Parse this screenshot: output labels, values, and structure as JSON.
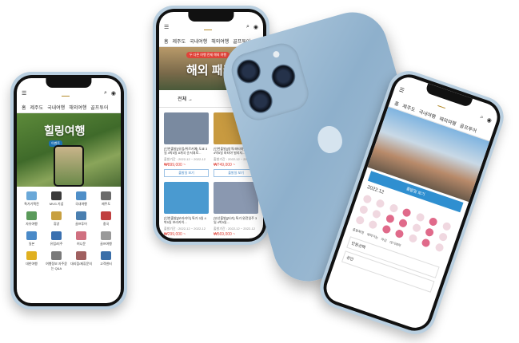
{
  "phone_left": {
    "nav": [
      "홈",
      "제주도",
      "국내여행",
      "해외여행",
      "골프투어"
    ],
    "hero_text": "힐링여행",
    "hero_badge": "이벤트",
    "grid": [
      {
        "label": "특가기획전",
        "color": "#6aa8d8"
      },
      {
        "label": "MVG 기념",
        "color": "#3a3a3a"
      },
      {
        "label": "국내여행",
        "color": "#4f8fc8"
      },
      {
        "label": "제주도",
        "color": "#6b6b6b"
      },
      {
        "label": "자유여행",
        "color": "#5a9a5a"
      },
      {
        "label": "휴양",
        "color": "#c8a040"
      },
      {
        "label": "골프투어",
        "color": "#4a7fb0"
      },
      {
        "label": "중국",
        "color": "#c04040"
      },
      {
        "label": "일본",
        "color": "#4a8ac8"
      },
      {
        "label": "유럽/미주",
        "color": "#3a70b0"
      },
      {
        "label": "허니문",
        "color": "#d07080"
      },
      {
        "label": "골프여행",
        "color": "#999999"
      },
      {
        "label": "대한여행",
        "color": "#e0b020"
      },
      {
        "label": "여행정보 자주묻는 Q&A",
        "color": "#7a7a7a"
      },
      {
        "label": "대리점/제휴문의",
        "color": "#a06060"
      },
      {
        "label": "고객센터",
        "color": "#3a6ea8"
      }
    ]
  },
  "phone_middle": {
    "nav": [
      "홈",
      "제주도",
      "국내여행",
      "해외여행",
      "골프투어"
    ],
    "hero_badge": "두 다른 여행 전제 해외 여행",
    "hero_text": "해외 패키지",
    "tabs": [
      "전체 →",
      "전체 ↓"
    ],
    "cards": [
      {
        "title": "[인천출발][유럽/튀르키예] 도쿄 3일 4박5일 8개국 순서대로...",
        "date": "출발기간 : 2022-12 ~ 2022-12",
        "price": "₩899,000 ~",
        "button": "출발일 보기",
        "color": "#7a8aa0"
      },
      {
        "title": "[인천출발][방콕/파타야] 함께 3일 4박5일 파타야 빌리지...",
        "date": "출발기간 : 2022-12 ~ 2022-12",
        "price": "₩749,000 ~",
        "button": "출발일 보기",
        "color": "#c89a40"
      },
      {
        "title": "[인천출발][보라카이] 특가 3일 4박5일 보라카이...",
        "date": "출발기간 : 2022-12 ~ 2022-12",
        "price": "₩299,000 ~",
        "button": "출발일 보기",
        "color": "#4a9ad0"
      },
      {
        "title": "[부산출발][터키] 특가 완전일주 3일 4박5일...",
        "date": "출발기간 : 2022-12 ~ 2022-12",
        "price": "₩569,000 ~",
        "button": "출발일 보기",
        "color": "#8a98b0"
      }
    ]
  },
  "phone_right": {
    "nav": [
      "홈",
      "제주도",
      "국내여행",
      "해외여행",
      "골프투어"
    ],
    "date_label": "2022.12",
    "button": "출발일 보기",
    "legend": [
      "출발확정",
      "예약가능",
      "마감",
      "대기예약"
    ],
    "footer": "인원선택",
    "row2": "성인"
  }
}
